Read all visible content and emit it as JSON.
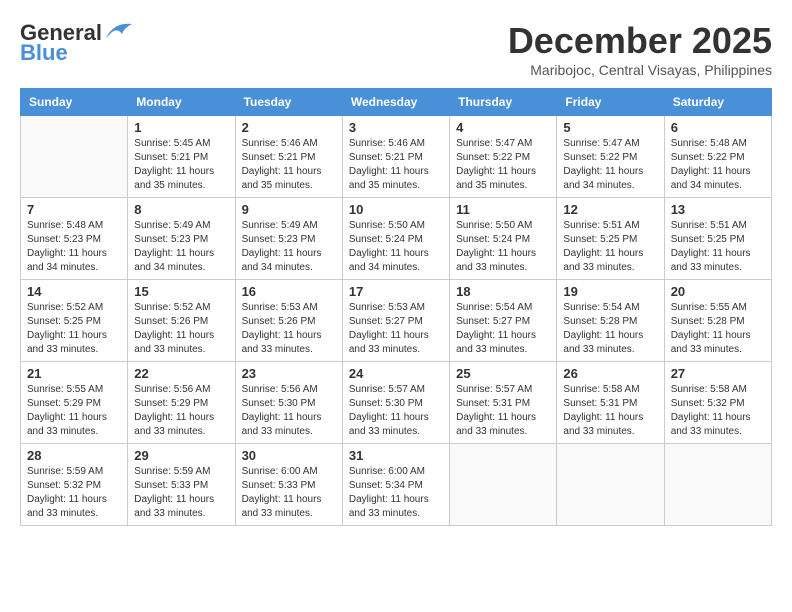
{
  "logo": {
    "general": "General",
    "blue": "Blue"
  },
  "title": "December 2025",
  "subtitle": "Maribojoc, Central Visayas, Philippines",
  "weekdays": [
    "Sunday",
    "Monday",
    "Tuesday",
    "Wednesday",
    "Thursday",
    "Friday",
    "Saturday"
  ],
  "weeks": [
    [
      {
        "day": "",
        "info": ""
      },
      {
        "day": "1",
        "info": "Sunrise: 5:45 AM\nSunset: 5:21 PM\nDaylight: 11 hours\nand 35 minutes."
      },
      {
        "day": "2",
        "info": "Sunrise: 5:46 AM\nSunset: 5:21 PM\nDaylight: 11 hours\nand 35 minutes."
      },
      {
        "day": "3",
        "info": "Sunrise: 5:46 AM\nSunset: 5:21 PM\nDaylight: 11 hours\nand 35 minutes."
      },
      {
        "day": "4",
        "info": "Sunrise: 5:47 AM\nSunset: 5:22 PM\nDaylight: 11 hours\nand 35 minutes."
      },
      {
        "day": "5",
        "info": "Sunrise: 5:47 AM\nSunset: 5:22 PM\nDaylight: 11 hours\nand 34 minutes."
      },
      {
        "day": "6",
        "info": "Sunrise: 5:48 AM\nSunset: 5:22 PM\nDaylight: 11 hours\nand 34 minutes."
      }
    ],
    [
      {
        "day": "7",
        "info": "Sunrise: 5:48 AM\nSunset: 5:23 PM\nDaylight: 11 hours\nand 34 minutes."
      },
      {
        "day": "8",
        "info": "Sunrise: 5:49 AM\nSunset: 5:23 PM\nDaylight: 11 hours\nand 34 minutes."
      },
      {
        "day": "9",
        "info": "Sunrise: 5:49 AM\nSunset: 5:23 PM\nDaylight: 11 hours\nand 34 minutes."
      },
      {
        "day": "10",
        "info": "Sunrise: 5:50 AM\nSunset: 5:24 PM\nDaylight: 11 hours\nand 34 minutes."
      },
      {
        "day": "11",
        "info": "Sunrise: 5:50 AM\nSunset: 5:24 PM\nDaylight: 11 hours\nand 33 minutes."
      },
      {
        "day": "12",
        "info": "Sunrise: 5:51 AM\nSunset: 5:25 PM\nDaylight: 11 hours\nand 33 minutes."
      },
      {
        "day": "13",
        "info": "Sunrise: 5:51 AM\nSunset: 5:25 PM\nDaylight: 11 hours\nand 33 minutes."
      }
    ],
    [
      {
        "day": "14",
        "info": "Sunrise: 5:52 AM\nSunset: 5:25 PM\nDaylight: 11 hours\nand 33 minutes."
      },
      {
        "day": "15",
        "info": "Sunrise: 5:52 AM\nSunset: 5:26 PM\nDaylight: 11 hours\nand 33 minutes."
      },
      {
        "day": "16",
        "info": "Sunrise: 5:53 AM\nSunset: 5:26 PM\nDaylight: 11 hours\nand 33 minutes."
      },
      {
        "day": "17",
        "info": "Sunrise: 5:53 AM\nSunset: 5:27 PM\nDaylight: 11 hours\nand 33 minutes."
      },
      {
        "day": "18",
        "info": "Sunrise: 5:54 AM\nSunset: 5:27 PM\nDaylight: 11 hours\nand 33 minutes."
      },
      {
        "day": "19",
        "info": "Sunrise: 5:54 AM\nSunset: 5:28 PM\nDaylight: 11 hours\nand 33 minutes."
      },
      {
        "day": "20",
        "info": "Sunrise: 5:55 AM\nSunset: 5:28 PM\nDaylight: 11 hours\nand 33 minutes."
      }
    ],
    [
      {
        "day": "21",
        "info": "Sunrise: 5:55 AM\nSunset: 5:29 PM\nDaylight: 11 hours\nand 33 minutes."
      },
      {
        "day": "22",
        "info": "Sunrise: 5:56 AM\nSunset: 5:29 PM\nDaylight: 11 hours\nand 33 minutes."
      },
      {
        "day": "23",
        "info": "Sunrise: 5:56 AM\nSunset: 5:30 PM\nDaylight: 11 hours\nand 33 minutes."
      },
      {
        "day": "24",
        "info": "Sunrise: 5:57 AM\nSunset: 5:30 PM\nDaylight: 11 hours\nand 33 minutes."
      },
      {
        "day": "25",
        "info": "Sunrise: 5:57 AM\nSunset: 5:31 PM\nDaylight: 11 hours\nand 33 minutes."
      },
      {
        "day": "26",
        "info": "Sunrise: 5:58 AM\nSunset: 5:31 PM\nDaylight: 11 hours\nand 33 minutes."
      },
      {
        "day": "27",
        "info": "Sunrise: 5:58 AM\nSunset: 5:32 PM\nDaylight: 11 hours\nand 33 minutes."
      }
    ],
    [
      {
        "day": "28",
        "info": "Sunrise: 5:59 AM\nSunset: 5:32 PM\nDaylight: 11 hours\nand 33 minutes."
      },
      {
        "day": "29",
        "info": "Sunrise: 5:59 AM\nSunset: 5:33 PM\nDaylight: 11 hours\nand 33 minutes."
      },
      {
        "day": "30",
        "info": "Sunrise: 6:00 AM\nSunset: 5:33 PM\nDaylight: 11 hours\nand 33 minutes."
      },
      {
        "day": "31",
        "info": "Sunrise: 6:00 AM\nSunset: 5:34 PM\nDaylight: 11 hours\nand 33 minutes."
      },
      {
        "day": "",
        "info": ""
      },
      {
        "day": "",
        "info": ""
      },
      {
        "day": "",
        "info": ""
      }
    ]
  ]
}
